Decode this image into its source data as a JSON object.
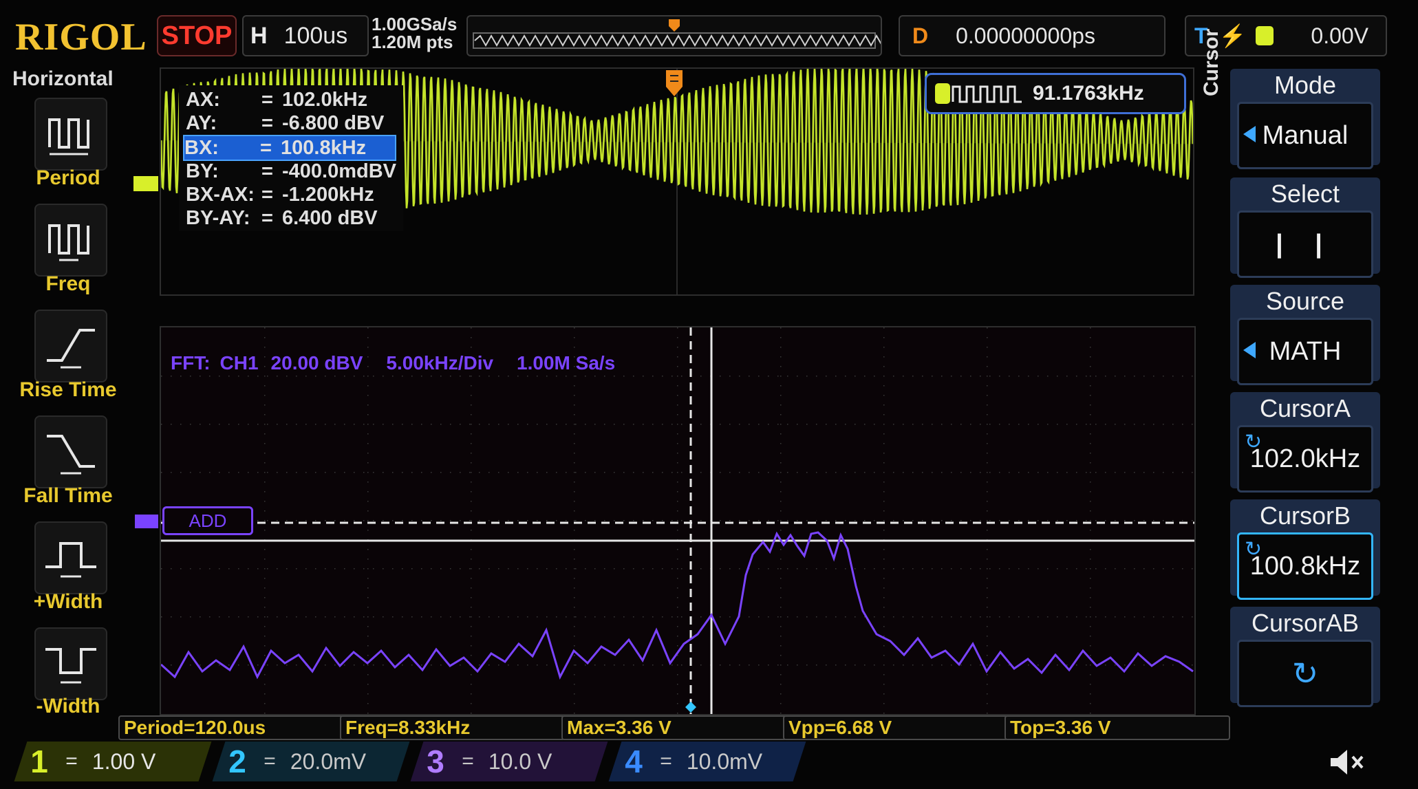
{
  "header": {
    "brand": "RIGOL",
    "run_state": "STOP",
    "horizontal": {
      "label": "H",
      "timebase": "100us"
    },
    "acquisition": {
      "sample_rate": "1.00GSa/s",
      "memory_depth": "1.20M pts"
    },
    "delay": {
      "label": "D",
      "value": "0.00000000ps"
    },
    "trigger": {
      "label": "T",
      "edge_icon": "rising-edge-icon",
      "source": "1",
      "level": "0.00V"
    }
  },
  "left_menu": {
    "title": "Horizontal",
    "items": [
      {
        "label": "Period",
        "icon": "period-icon"
      },
      {
        "label": "Freq",
        "icon": "frequency-icon"
      },
      {
        "label": "Rise Time",
        "icon": "rise-time-icon"
      },
      {
        "label": "Fall Time",
        "icon": "fall-time-icon"
      },
      {
        "label": "+Width",
        "icon": "positive-width-icon"
      },
      {
        "label": "-Width",
        "icon": "negative-width-icon"
      }
    ]
  },
  "cursor_readout": [
    {
      "key": "AX:",
      "eq": "=",
      "value": "102.0kHz",
      "selected": false
    },
    {
      "key": "AY:",
      "eq": "=",
      "value": "-6.800 dBV",
      "selected": false
    },
    {
      "key": "BX:",
      "eq": "=",
      "value": "100.8kHz",
      "selected": true
    },
    {
      "key": "BY:",
      "eq": "=",
      "value": "-400.0mdBV",
      "selected": false
    },
    {
      "key": "BX-AX:",
      "eq": "=",
      "value": "-1.200kHz",
      "selected": false
    },
    {
      "key": "BY-AY:",
      "eq": "=",
      "value": "6.400 dBV",
      "selected": false
    }
  ],
  "counter": {
    "value": "91.1763kHz",
    "icon": "pulse-train-icon"
  },
  "ch1_marker": "1",
  "fft_info": {
    "source": "FFT:",
    "channel": "CH1",
    "scale": "20.00 dBV",
    "span": "5.00kHz/Div",
    "rate": "1.00M Sa/s"
  },
  "math_label": "ADD",
  "side_label": "Cursor",
  "right_menu": {
    "mode": {
      "title": "Mode",
      "value": "Manual"
    },
    "select": {
      "title": "Select",
      "value": "| |"
    },
    "source": {
      "title": "Source",
      "value": "MATH"
    },
    "cursor_a": {
      "title": "CursorA",
      "value": "102.0kHz"
    },
    "cursor_b": {
      "title": "CursorB",
      "value": "100.8kHz"
    },
    "cursor_ab": {
      "title": "CursorAB",
      "icon": "rotate-knob-icon"
    }
  },
  "measurements": [
    "Period=120.0us",
    "Freq=8.33kHz",
    "Max=3.36 V",
    "Vpp=6.68 V",
    "Top=3.36 V"
  ],
  "channels": [
    {
      "num": "1",
      "coupling": "=",
      "scale": "1.00 V",
      "color": "#d8ef2a",
      "bg": "#3b4508"
    },
    {
      "num": "2",
      "coupling": "=",
      "scale": "20.0mV",
      "color": "#33c6ff",
      "bg": "#0e2e3e"
    },
    {
      "num": "3",
      "coupling": "=",
      "scale": "10.0 V",
      "color": "#b07cff",
      "bg": "#2a1648"
    },
    {
      "num": "4",
      "coupling": "=",
      "scale": "10.0mV",
      "color": "#3a8bff",
      "bg": "#10254d"
    }
  ],
  "speaker_icon": "speaker-muted-icon",
  "colors": {
    "ch1": "#d8ef2a",
    "math": "#7a43ff",
    "accent": "#f2c230"
  }
}
